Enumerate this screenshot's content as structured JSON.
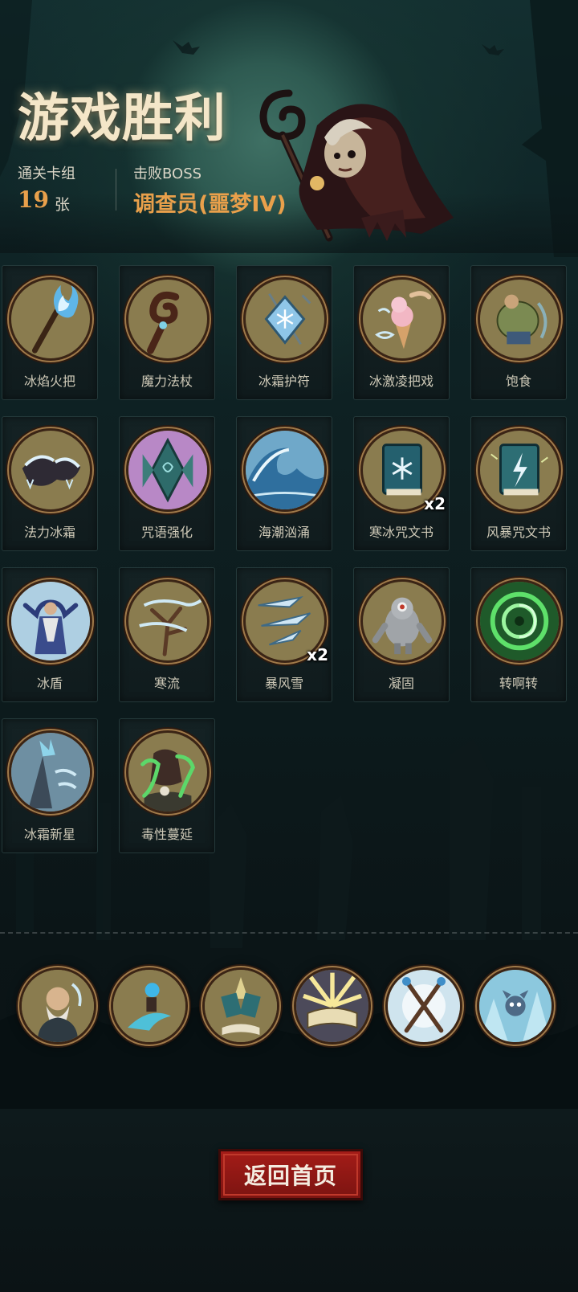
{
  "title": "游戏胜利",
  "stats": {
    "deck_label": "通关卡组",
    "deck_count": "19",
    "deck_unit": "张",
    "boss_label": "击败BOSS",
    "boss_name": "调查员(噩梦IV)"
  },
  "cards": [
    {
      "label": "冰焰火把",
      "icon": "ice-torch-icon",
      "badge": ""
    },
    {
      "label": "魔力法杖",
      "icon": "magic-staff-icon",
      "badge": ""
    },
    {
      "label": "冰霜护符",
      "icon": "frost-amulet-icon",
      "badge": ""
    },
    {
      "label": "冰激凌把戏",
      "icon": "ice-cream-icon",
      "badge": ""
    },
    {
      "label": "饱食",
      "icon": "satiated-icon",
      "badge": ""
    },
    {
      "label": "法力冰霜",
      "icon": "mana-frost-icon",
      "badge": ""
    },
    {
      "label": "咒语强化",
      "icon": "spell-boost-icon",
      "badge": ""
    },
    {
      "label": "海潮汹涌",
      "icon": "tidal-wave-icon",
      "badge": ""
    },
    {
      "label": "寒冰咒文书",
      "icon": "ice-spellbook-icon",
      "badge": "x2"
    },
    {
      "label": "风暴咒文书",
      "icon": "storm-spellbook-icon",
      "badge": ""
    },
    {
      "label": "冰盾",
      "icon": "ice-shield-icon",
      "badge": ""
    },
    {
      "label": "寒流",
      "icon": "cold-current-icon",
      "badge": ""
    },
    {
      "label": "暴风雪",
      "icon": "blizzard-icon",
      "badge": "x2"
    },
    {
      "label": "凝固",
      "icon": "solidify-icon",
      "badge": ""
    },
    {
      "label": "转啊转",
      "icon": "spin-vortex-icon",
      "badge": ""
    },
    {
      "label": "冰霜新星",
      "icon": "frost-nova-icon",
      "badge": ""
    },
    {
      "label": "毒性蔓延",
      "icon": "toxic-spread-icon",
      "badge": ""
    }
  ],
  "relics": [
    {
      "icon": "old-sage-relic-icon"
    },
    {
      "icon": "crystal-orb-relic-icon"
    },
    {
      "icon": "twin-books-relic-icon"
    },
    {
      "icon": "glowing-book-relic-icon"
    },
    {
      "icon": "crossed-staffs-relic-icon"
    },
    {
      "icon": "ice-creature-relic-icon"
    }
  ],
  "home_button": "返回首页",
  "colors": {
    "accent_orange": "#e9a04b",
    "title_cream": "#f4e6c8",
    "button_red": "#a41c18",
    "card_frame_bronze": "#a07a4a",
    "art_background": "#8a7c4f",
    "badge_white": "#ffffff"
  }
}
